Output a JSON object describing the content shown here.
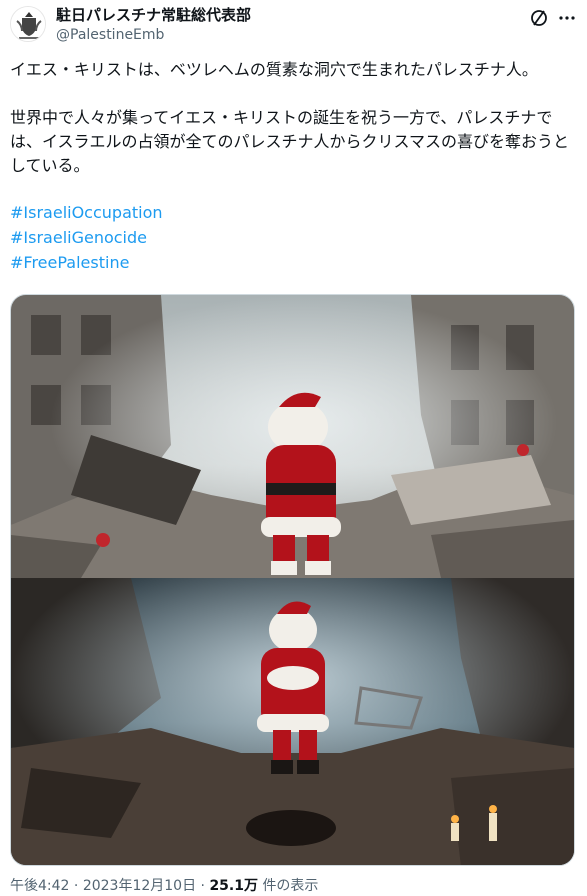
{
  "tweet": {
    "display_name": "駐日パレスチナ常駐総代表部",
    "handle": "@PalestineEmb",
    "paragraph1": "イエス・キリストは、ベツレヘムの質素な洞穴で生まれたパレスチナ人。",
    "paragraph2": "世界中で人々が集ってイエス・キリストの誕生を祝う一方で、パレスチナでは、イスラエルの占領が全てのパレスチナ人からクリスマスの喜びを奪おうとしている。",
    "hashtags": [
      "#IsraeliOccupation",
      "#IsraeliGenocide",
      "#FreePalestine"
    ],
    "time": "午後4:42",
    "date": "2023年12月10日",
    "views_count": "25.1万",
    "views_label": "件の表示",
    "separator": "·",
    "colors": {
      "link": "#1d9bf0",
      "secondary": "#536471",
      "santa_red": "#b3121b"
    },
    "icons": [
      "grok-icon",
      "more-icon"
    ]
  }
}
